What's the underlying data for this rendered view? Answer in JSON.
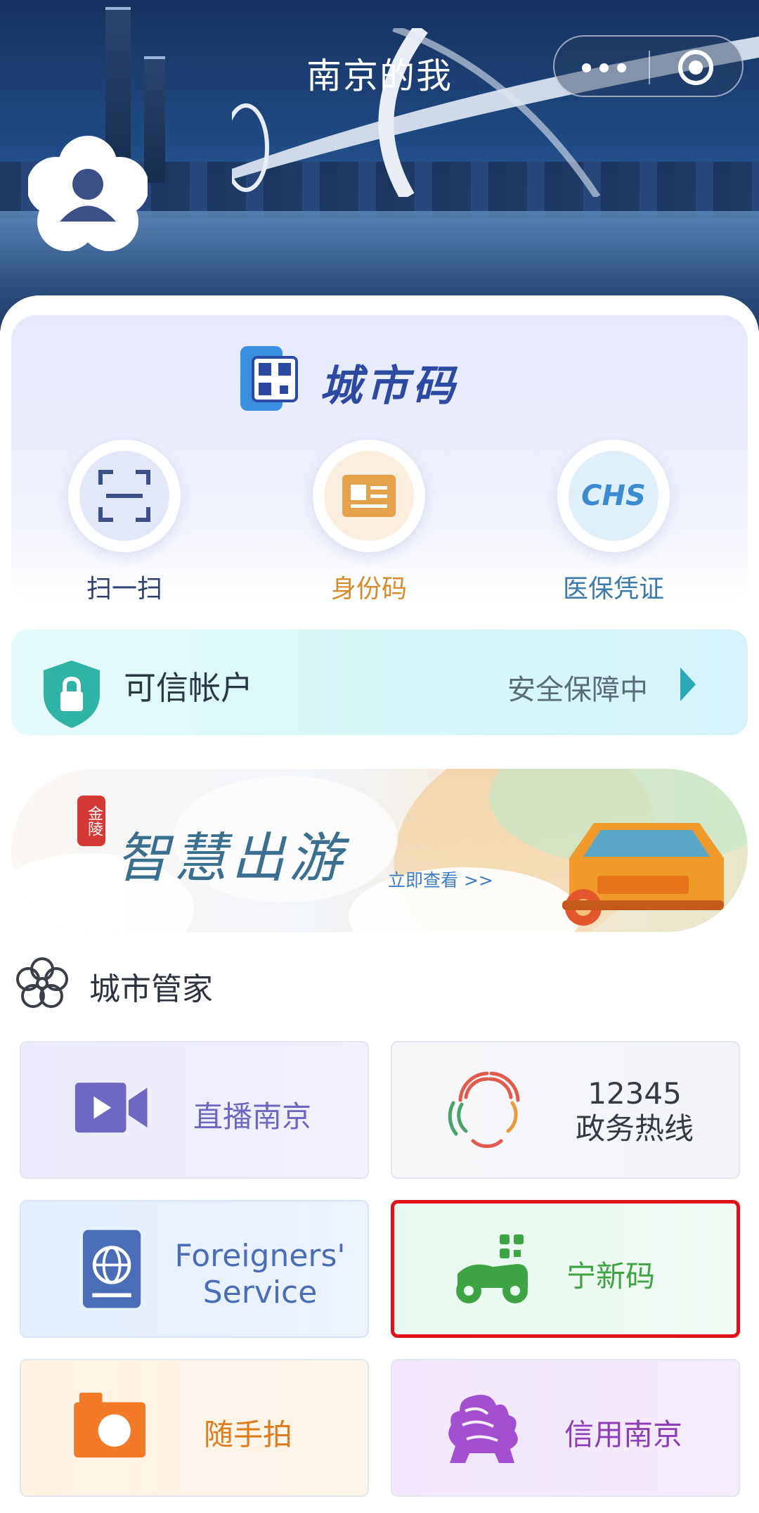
{
  "header": {
    "title": "南京的我"
  },
  "city_code": {
    "title": "城市码",
    "actions": [
      {
        "label": "扫一扫",
        "icon": "scan-icon",
        "color": "#2d4070"
      },
      {
        "label": "身份码",
        "icon": "id-card-icon",
        "color": "#d88b2c"
      },
      {
        "label": "医保凭证",
        "icon": "chs-icon",
        "icon_text": "CHS",
        "color": "#3b7aaa"
      }
    ]
  },
  "trusted_account": {
    "title": "可信帐户",
    "status": "安全保障中"
  },
  "banner": {
    "seal": "金陵",
    "title": "智慧出游",
    "link": "立即查看 >>"
  },
  "section": {
    "title": "城市管家"
  },
  "services": [
    {
      "label": "直播南京",
      "icon": "video-camera-icon",
      "color": "#6e68c2"
    },
    {
      "label_top": "12345",
      "label_bottom": "政务热线",
      "icon": "hotline-icon",
      "color": "#333a44"
    },
    {
      "label_top": "Foreigners'",
      "label_bottom": "Service",
      "icon": "passport-icon",
      "color": "#4a6db8"
    },
    {
      "label": "宁新码",
      "icon": "scooter-qr-icon",
      "color": "#3ea342"
    },
    {
      "label": "随手拍",
      "icon": "camera-icon",
      "color": "#e07b1e"
    },
    {
      "label": "信用南京",
      "icon": "lion-icon",
      "color": "#8c3fb8"
    }
  ]
}
